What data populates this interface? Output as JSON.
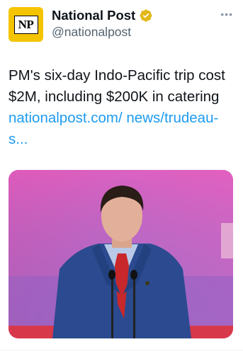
{
  "account": {
    "display_name": "National Post",
    "handle": "@nationalpost",
    "avatar_text": "NP",
    "verified_icon": "gold-verified-badge-icon",
    "more_icon": "more-options-icon"
  },
  "tweet": {
    "text": "PM's six-day Indo-Pacific trip cost $2M, including $200K in catering",
    "link_line1": "nationalpost.com/",
    "link_line2": "news/trudeau-s..."
  },
  "media": {
    "description_icon": "photo-of-man-in-blue-suit-at-podium"
  },
  "colors": {
    "avatar_bg": "#f5c400",
    "link": "#1d9bf0",
    "handle": "#536471",
    "verified_gold": "#e2b719"
  }
}
